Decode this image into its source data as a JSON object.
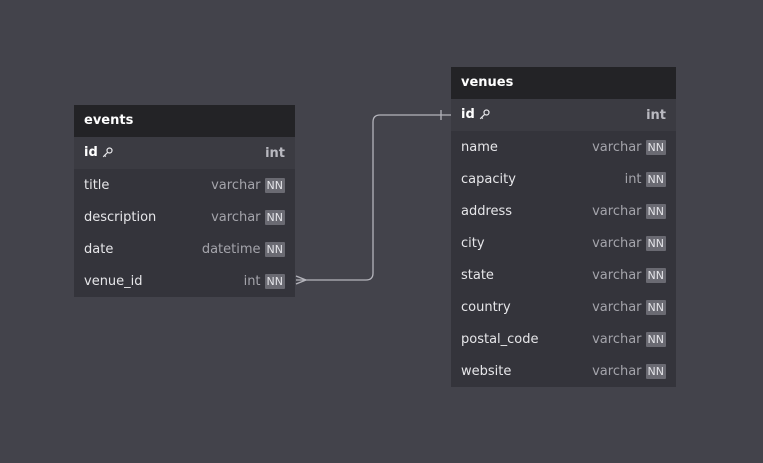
{
  "tables": [
    {
      "title": "events",
      "columns": [
        {
          "name": "id",
          "type": "int",
          "pk": true,
          "nn": ""
        },
        {
          "name": "title",
          "type": "varchar",
          "pk": false,
          "nn": "NN"
        },
        {
          "name": "description",
          "type": "varchar",
          "pk": false,
          "nn": "NN"
        },
        {
          "name": "date",
          "type": "datetime",
          "pk": false,
          "nn": "NN"
        },
        {
          "name": "venue_id",
          "type": "int",
          "pk": false,
          "nn": "NN"
        }
      ]
    },
    {
      "title": "venues",
      "columns": [
        {
          "name": "id",
          "type": "int",
          "pk": true,
          "nn": ""
        },
        {
          "name": "name",
          "type": "varchar",
          "pk": false,
          "nn": "NN"
        },
        {
          "name": "capacity",
          "type": "int",
          "pk": false,
          "nn": "NN"
        },
        {
          "name": "address",
          "type": "varchar",
          "pk": false,
          "nn": "NN"
        },
        {
          "name": "city",
          "type": "varchar",
          "pk": false,
          "nn": "NN"
        },
        {
          "name": "state",
          "type": "varchar",
          "pk": false,
          "nn": "NN"
        },
        {
          "name": "country",
          "type": "varchar",
          "pk": false,
          "nn": "NN"
        },
        {
          "name": "postal_code",
          "type": "varchar",
          "pk": false,
          "nn": "NN"
        },
        {
          "name": "website",
          "type": "varchar",
          "pk": false,
          "nn": "NN"
        }
      ]
    }
  ],
  "relationships": [
    {
      "from": "events.venue_id",
      "to": "venues.id",
      "from_end": "many",
      "to_end": "one"
    }
  ],
  "colors": {
    "background": "#43434b",
    "table_body": "#34343b",
    "table_header": "#232326",
    "edge": "#b4b4bb"
  }
}
